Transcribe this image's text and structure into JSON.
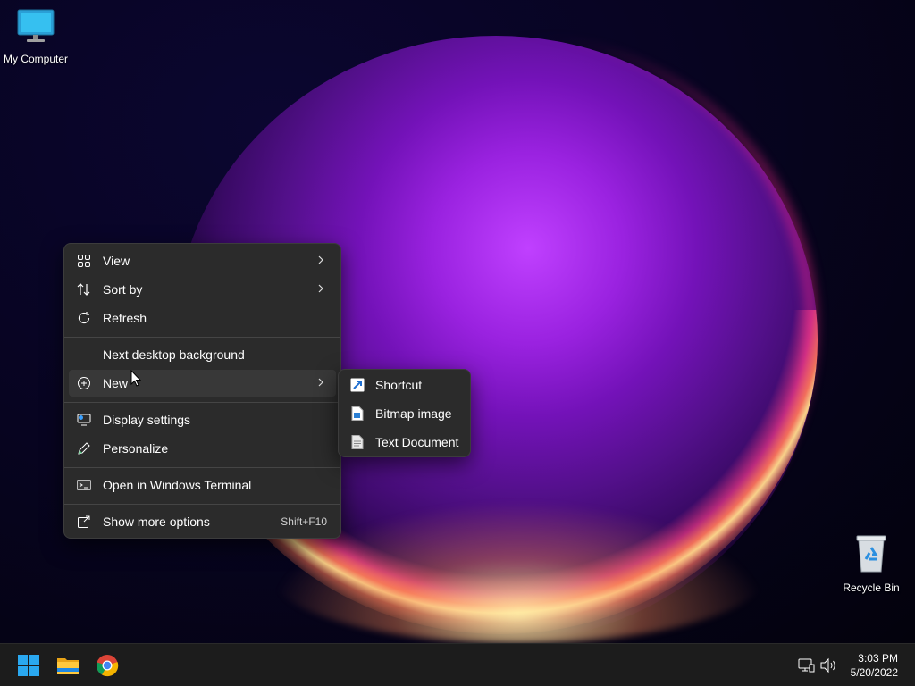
{
  "desktop": {
    "icons": [
      {
        "name": "my-computer",
        "label": "My Computer"
      },
      {
        "name": "recycle-bin",
        "label": "Recycle Bin"
      }
    ]
  },
  "context_menu": {
    "items": [
      {
        "label": "View",
        "icon": "view-grid-icon",
        "submenu": true
      },
      {
        "label": "Sort by",
        "icon": "sort-icon",
        "submenu": true
      },
      {
        "label": "Refresh",
        "icon": "refresh-icon"
      },
      {
        "label": "Next desktop background",
        "icon": ""
      },
      {
        "label": "New",
        "icon": "add-circle-icon",
        "submenu": true,
        "highlighted": true
      },
      {
        "label": "Display settings",
        "icon": "display-settings-icon"
      },
      {
        "label": "Personalize",
        "icon": "pen-icon"
      },
      {
        "label": "Open in Windows Terminal",
        "icon": "terminal-icon"
      },
      {
        "label": "Show more options",
        "icon": "open-external-icon",
        "shortcut": "Shift+F10"
      }
    ]
  },
  "new_submenu": {
    "items": [
      {
        "label": "Shortcut",
        "icon": "shortcut-icon"
      },
      {
        "label": "Bitmap image",
        "icon": "bitmap-file-icon"
      },
      {
        "label": "Text Document",
        "icon": "text-file-icon"
      }
    ]
  },
  "taskbar": {
    "pinned": [
      "start-icon",
      "file-explorer-icon",
      "chrome-icon"
    ],
    "tray": [
      "network-icon",
      "volume-icon"
    ],
    "time": "3:03 PM",
    "date": "5/20/2022"
  },
  "colors": {
    "menu_bg": "#2b2b2b",
    "menu_hover": "#383838",
    "taskbar_bg": "#1c1c1c",
    "accent": "#0078d4"
  }
}
